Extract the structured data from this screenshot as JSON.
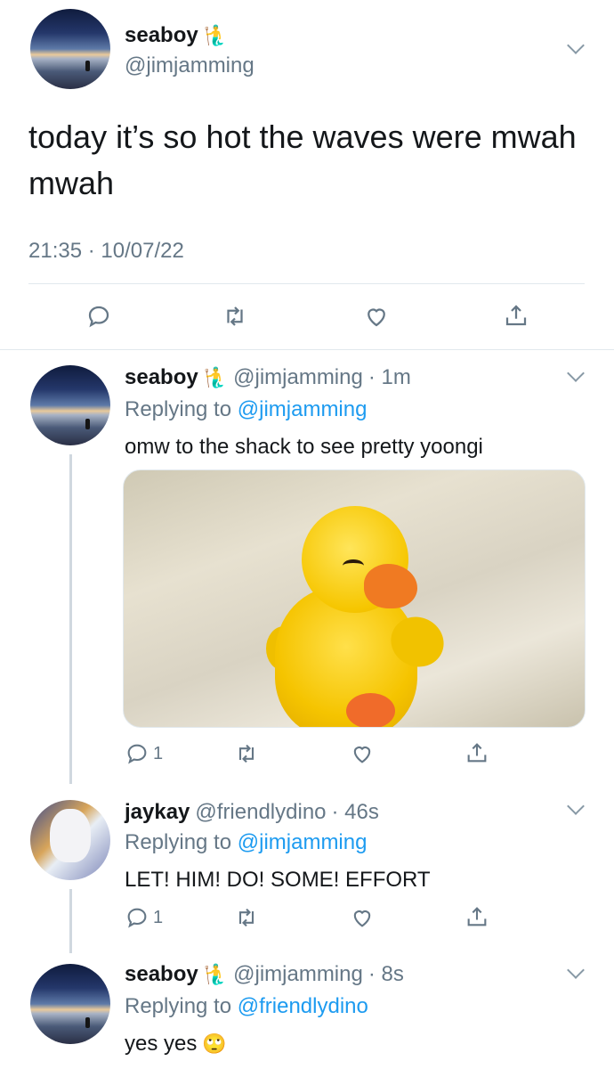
{
  "main_tweet": {
    "display_name": "seaboy",
    "name_emoji": "🧜‍♂️",
    "handle": "@jimjamming",
    "text": "today it’s so hot the waves were mwah mwah",
    "timestamp": "21:35 · 10/07/22"
  },
  "replies": [
    {
      "display_name": "seaboy",
      "name_emoji": "🧜‍♂️",
      "handle": "@jimjamming",
      "time": "· 1m",
      "replying_prefix": "Replying to",
      "replying_to": "@jimjamming",
      "text": "omw to the shack to see pretty yoongi",
      "reply_count": "1"
    },
    {
      "display_name": "jaykay",
      "handle": "@friendlydino",
      "time": "· 46s",
      "replying_prefix": "Replying to",
      "replying_to": "@jimjamming",
      "text": "LET! HIM! DO! SOME! EFFORT",
      "reply_count": "1"
    },
    {
      "display_name": "seaboy",
      "name_emoji": "🧜‍♂️",
      "handle": "@jimjamming",
      "time": "· 8s",
      "replying_prefix": "Replying to",
      "replying_to": "@friendlydino",
      "text": "yes yes",
      "text_emoji": "🙄"
    }
  ],
  "colors": {
    "link": "#1d9bf0",
    "muted": "#657786",
    "divider": "#e1e8ed"
  },
  "icons": [
    "reply-icon",
    "retweet-icon",
    "like-icon",
    "share-icon",
    "chevron-down-icon"
  ]
}
